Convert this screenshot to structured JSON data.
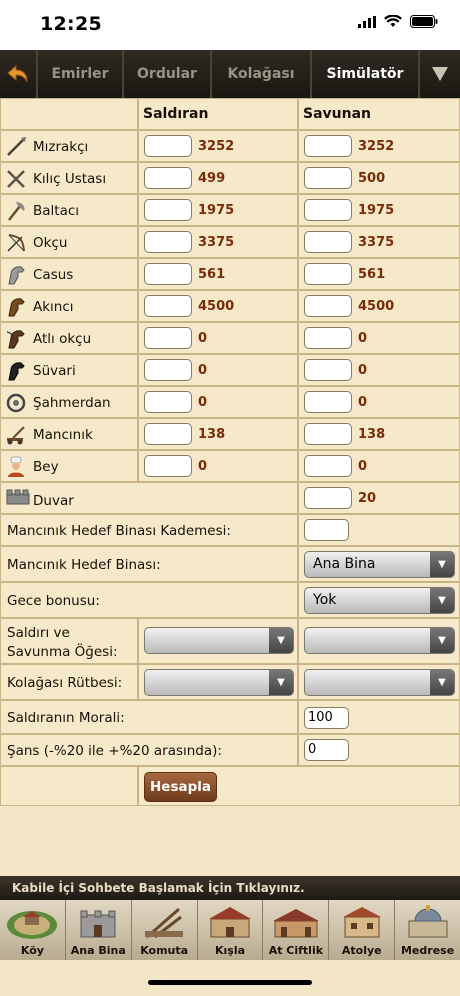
{
  "status_bar": {
    "time": "12:25"
  },
  "nav": {
    "back_icon": "back-arrow-icon",
    "tabs": [
      {
        "label": "Emirler",
        "active": false
      },
      {
        "label": "Ordular",
        "active": false
      },
      {
        "label": "Kolağası",
        "active": false
      },
      {
        "label": "Simülatör",
        "active": true
      }
    ],
    "menu_icon": "triangle-down-icon"
  },
  "table": {
    "col_attacker": "Saldıran",
    "col_defender": "Savunan",
    "units": [
      {
        "name": "Mızrakçı",
        "icon": "spear-icon",
        "attacker": "3252",
        "defender": "3252"
      },
      {
        "name": "Kılıç Ustası",
        "icon": "crossed-swords-icon",
        "attacker": "499",
        "defender": "500"
      },
      {
        "name": "Baltacı",
        "icon": "axe-icon",
        "attacker": "1975",
        "defender": "1975"
      },
      {
        "name": "Okçu",
        "icon": "bow-icon",
        "attacker": "3375",
        "defender": "3375"
      },
      {
        "name": "Casus",
        "icon": "scout-horse-icon",
        "attacker": "561",
        "defender": "561"
      },
      {
        "name": "Akıncı",
        "icon": "light-cavalry-icon",
        "attacker": "4500",
        "defender": "4500"
      },
      {
        "name": "Atlı okçu",
        "icon": "horse-archer-icon",
        "attacker": "0",
        "defender": "0"
      },
      {
        "name": "Süvari",
        "icon": "heavy-cavalry-icon",
        "attacker": "0",
        "defender": "0"
      },
      {
        "name": "Şahmerdan",
        "icon": "ram-icon",
        "attacker": "0",
        "defender": "0"
      },
      {
        "name": "Mancınık",
        "icon": "catapult-icon",
        "attacker": "138",
        "defender": "138"
      },
      {
        "name": "Bey",
        "icon": "noble-icon",
        "attacker": "0",
        "defender": "0"
      }
    ],
    "wall": {
      "name": "Duvar",
      "icon": "wall-icon",
      "value": "20"
    },
    "catapult_level_label": "Mancınık Hedef Binası Kademesi:",
    "catapult_target_label": "Mancınık Hedef Binası:",
    "catapult_target_value": "Ana Bina",
    "night_bonus_label": "Gece bonusu:",
    "night_bonus_value": "Yok",
    "item_label": "Saldırı ve Savunma Öğesi:",
    "rank_label": "Kolağası Rütbesi:",
    "morale_label": "Saldıranın Morali:",
    "morale_value": "100",
    "luck_label": "Şans (-%20 ile +%20 arasında):",
    "luck_value": "0",
    "calculate_label": "Hesapla"
  },
  "chat": {
    "text": "Kabile İçi Sohbete Başlamak İçin Tıklayınız."
  },
  "dock": [
    {
      "label": "Köy",
      "icon": "village-icon"
    },
    {
      "label": "Ana Bina",
      "icon": "main-building-icon"
    },
    {
      "label": "Komuta",
      "icon": "rally-point-icon"
    },
    {
      "label": "Kışla",
      "icon": "barracks-icon"
    },
    {
      "label": "At Ciftlik",
      "icon": "stable-icon"
    },
    {
      "label": "Atolye",
      "icon": "workshop-icon"
    },
    {
      "label": "Medrese",
      "icon": "academy-icon"
    }
  ],
  "colors": {
    "accent": "#7a2a06",
    "background": "#f3e6c6",
    "navbar": "#1f1b15",
    "button": "#8b4c27"
  }
}
